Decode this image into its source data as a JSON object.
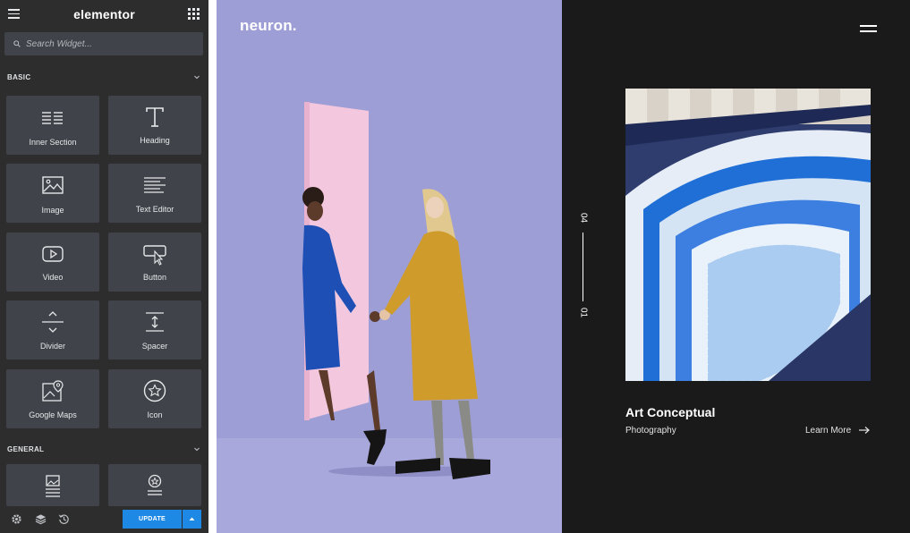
{
  "panel": {
    "brand": "elementor",
    "search": {
      "placeholder": "Search Widget..."
    },
    "categories": {
      "basic": "BASIC",
      "general": "GENERAL"
    },
    "widgets": [
      {
        "label": "Inner Section",
        "icon": "inner-section-icon"
      },
      {
        "label": "Heading",
        "icon": "heading-icon"
      },
      {
        "label": "Image",
        "icon": "image-icon"
      },
      {
        "label": "Text Editor",
        "icon": "text-editor-icon"
      },
      {
        "label": "Video",
        "icon": "video-icon"
      },
      {
        "label": "Button",
        "icon": "button-icon"
      },
      {
        "label": "Divider",
        "icon": "divider-icon"
      },
      {
        "label": "Spacer",
        "icon": "spacer-icon"
      },
      {
        "label": "Google Maps",
        "icon": "google-maps-icon"
      },
      {
        "label": "Icon",
        "icon": "star-icon"
      }
    ],
    "general_widgets": [
      {
        "icon": "image-box-icon"
      },
      {
        "icon": "icon-box-icon"
      }
    ],
    "footer": {
      "update_label": "UPDATE",
      "icons": [
        "settings-icon",
        "navigator-layers-icon",
        "history-icon",
        "caret-up-icon"
      ]
    }
  },
  "preview": {
    "logo": "neuron.",
    "pager": {
      "current": "01",
      "total": "04"
    },
    "project": {
      "title": "Art Conceptual",
      "category": "Photography",
      "link": "Learn More"
    }
  },
  "colors": {
    "panel_bg": "#2d2d2e",
    "tile_bg": "#404349",
    "accent": "#1e88e5",
    "hero_bg": "#9e9ed6",
    "dark_bg": "#1a1a1a"
  }
}
